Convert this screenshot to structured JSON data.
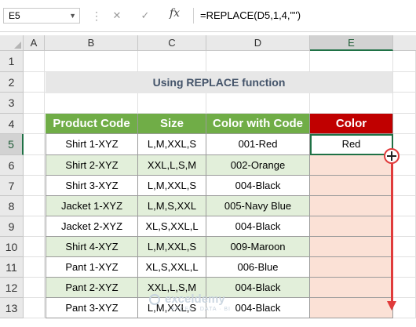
{
  "formula_bar": {
    "name_box": "E5",
    "fx_label": "fx",
    "formula": "=REPLACE(D5,1,4,\"\")"
  },
  "columns": [
    "A",
    "B",
    "C",
    "D",
    "E"
  ],
  "rows": [
    "1",
    "2",
    "3",
    "4",
    "5",
    "6",
    "7",
    "8",
    "9",
    "10",
    "11",
    "12",
    "13"
  ],
  "title": "Using REPLACE function",
  "table": {
    "headers": [
      "Product Code",
      "Size",
      "Color with Code",
      "Color"
    ],
    "rows": [
      [
        "Shirt 1-XYZ",
        "L,M,XXL,S",
        "001-Red",
        "Red"
      ],
      [
        "Shirt 2-XYZ",
        "XXL,L,S,M",
        "002-Orange",
        ""
      ],
      [
        "Shirt 3-XYZ",
        "L,M,XXL,S",
        "004-Black",
        ""
      ],
      [
        "Jacket 1-XYZ",
        "L,M,S,XXL",
        "005-Navy Blue",
        ""
      ],
      [
        "Jacket 2-XYZ",
        "XL,S,XXL,L",
        "004-Black",
        ""
      ],
      [
        "Shirt 4-XYZ",
        "L,M,XXL,S",
        "009-Maroon",
        ""
      ],
      [
        "Pant 1-XYZ",
        "XL,S,XXL,L",
        "006-Blue",
        ""
      ],
      [
        "Pant 2-XYZ",
        "XXL,L,S,M",
        "004-Black",
        ""
      ],
      [
        "Pant 3-XYZ",
        "L,M,XXL,S",
        "004-Black",
        ""
      ]
    ]
  },
  "colors": {
    "header_green": "#70ad47",
    "header_red": "#c00000",
    "band_green": "#e2efda",
    "target_fill": "#fbe1d6",
    "drag_arrow": "#e03b3b",
    "selection": "#1f7145"
  },
  "watermark": {
    "brand": "exceldemy",
    "tagline": "EXCEL · DATA · BI"
  }
}
